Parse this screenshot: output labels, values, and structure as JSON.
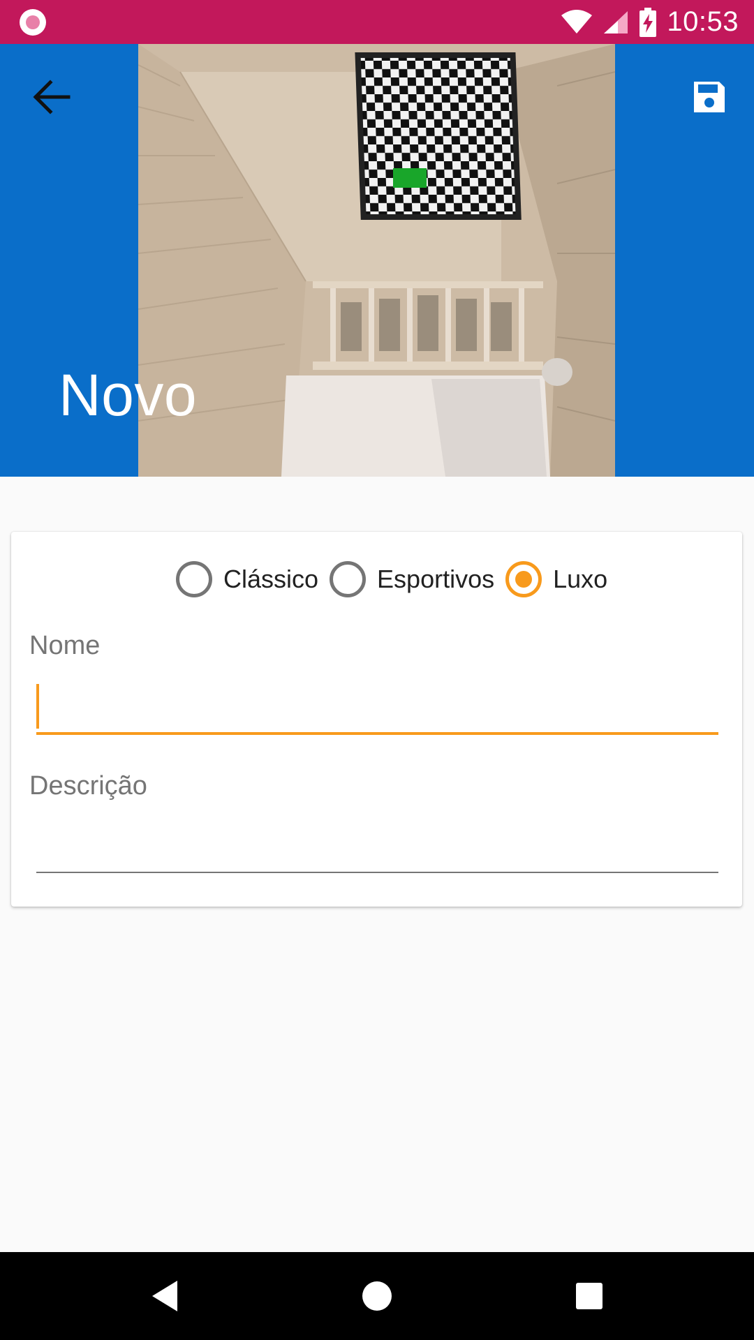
{
  "status_bar": {
    "time": "10:53",
    "icons": [
      "notification-icon",
      "wifi-icon",
      "cell-signal-icon",
      "battery-charging-icon"
    ]
  },
  "header": {
    "title": "Novo",
    "back_icon": "arrow-back-icon",
    "save_icon": "save-icon",
    "background_color": "#0a6ec9",
    "image_description_icon": "room-photo"
  },
  "form": {
    "category_options": [
      {
        "label": "Clássico",
        "checked": false
      },
      {
        "label": "Esportivos",
        "checked": false
      },
      {
        "label": "Luxo",
        "checked": true
      }
    ],
    "name_field": {
      "label": "Nome",
      "value": ""
    },
    "description_field": {
      "label": "Descrição",
      "value": ""
    }
  },
  "colors": {
    "status_bar": "#c2185b",
    "accent": "#f89a1c",
    "primary": "#0a6ec9"
  },
  "nav_bar": {
    "icons": [
      "back-triangle-icon",
      "home-circle-icon",
      "recents-square-icon"
    ]
  }
}
